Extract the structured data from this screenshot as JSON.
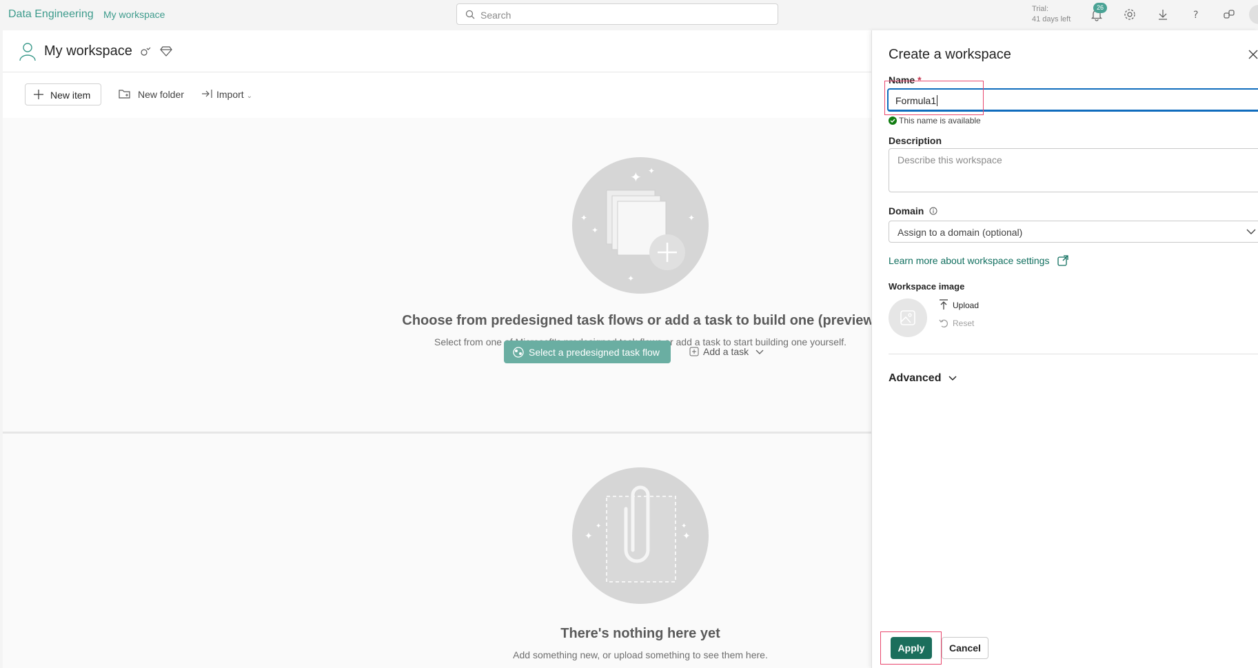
{
  "topbar": {
    "brand": "Data Engineering",
    "breadcrumb": "My workspace",
    "search_placeholder": "Search",
    "trial_label": "Trial:",
    "trial_days": "41 days left",
    "notification_count": "26"
  },
  "workspace": {
    "title": "My workspace",
    "toolbar": {
      "new_item": "New item",
      "new_folder": "New folder",
      "import": "Import"
    }
  },
  "task_flow": {
    "heading": "Choose from predesigned task flows or add a task to build one (preview)",
    "subtext": "Select from one of Microsoft's predesigned task flows or add a task to start building one yourself.",
    "select_button": "Select a predesigned task flow",
    "add_task": "Add a task"
  },
  "empty_state": {
    "heading": "There's nothing here yet",
    "subtext": "Add something new, or upload something to see them here."
  },
  "panel": {
    "title": "Create a workspace",
    "name_label": "Name",
    "required_mark": "*",
    "name_value": "Formula1",
    "availability": "This name is available",
    "description_label": "Description",
    "description_placeholder": "Describe this workspace",
    "domain_label": "Domain",
    "domain_placeholder": "Assign to a domain (optional)",
    "learn_more": "Learn more about workspace settings",
    "image_label": "Workspace image",
    "upload": "Upload",
    "reset": "Reset",
    "advanced": "Advanced",
    "apply": "Apply",
    "cancel": "Cancel"
  },
  "colors": {
    "brand_teal": "#3d9b8c",
    "primary_button": "#1b6e5c",
    "highlight": "#e8466c",
    "focus_blue": "#0f6cbd"
  }
}
